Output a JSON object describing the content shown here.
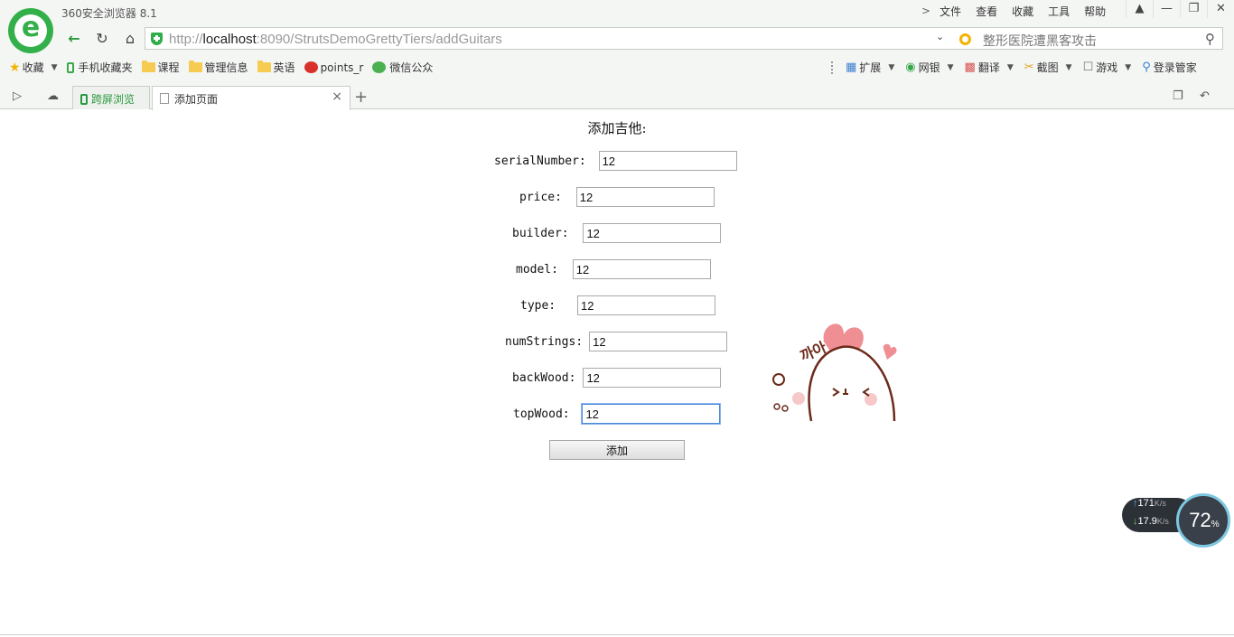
{
  "browser": {
    "app_title": "360安全浏览器 8.1",
    "menu": [
      "文件",
      "查看",
      "收藏",
      "工具",
      "帮助"
    ],
    "url_scheme": "http://",
    "url_host": "localhost",
    "url_rest": ":8090/StrutsDemoGrettyTiers/addGuitars",
    "search_text": "整形医院遭黑客攻击",
    "bookmarks": [
      "收藏",
      "手机收藏夹",
      "课程",
      "管理信息",
      "英语",
      "points_r",
      "微信公众"
    ],
    "tools": [
      "扩展",
      "网银",
      "翻译",
      "截图",
      "游戏",
      "登录管家"
    ],
    "tabs": [
      "跨屏浏览",
      "添加页面"
    ]
  },
  "form": {
    "title": "添加吉他:",
    "fields": [
      {
        "label": "serialNumber: ",
        "value": "12"
      },
      {
        "label": "price: ",
        "value": "12"
      },
      {
        "label": "builder: ",
        "value": "12"
      },
      {
        "label": "model: ",
        "value": "12"
      },
      {
        "label": "type: ",
        "value": "12"
      },
      {
        "label": "numStrings:",
        "value": "12"
      },
      {
        "label": "backWood:",
        "value": "12"
      },
      {
        "label": "topWood: ",
        "value": "12"
      }
    ],
    "submit_label": "添加"
  },
  "speed_widget": {
    "upload": "171",
    "upload_unit": "K/s",
    "download": "17.9",
    "download_unit": "K/s",
    "percent": "72",
    "percent_unit": "%"
  },
  "sticker_text": "까아"
}
